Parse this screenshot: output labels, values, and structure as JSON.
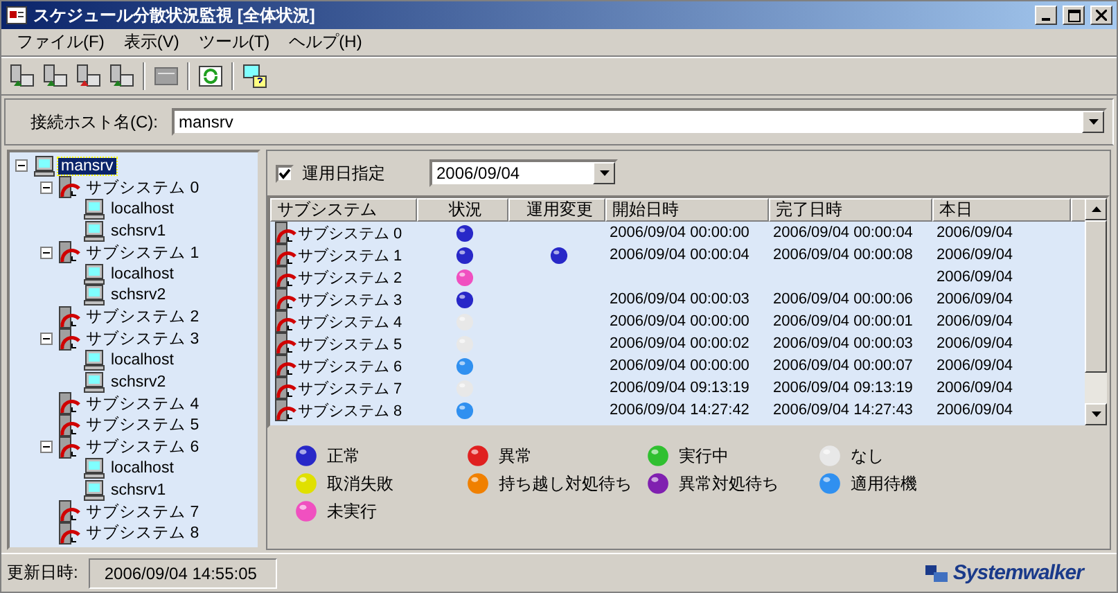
{
  "window": {
    "title": "スケジュール分散状況監視 [全体状況]"
  },
  "menu": [
    "ファイル(F)",
    "表示(V)",
    "ツール(T)",
    "ヘルプ(H)"
  ],
  "host": {
    "label": "接続ホスト名(C):",
    "value": "mansrv"
  },
  "tree": {
    "label": "mansrv",
    "selected": true,
    "expanded": true,
    "kind": "host",
    "children": [
      {
        "label": "サブシステム 0",
        "kind": "subsystem",
        "expanded": true,
        "children": [
          {
            "label": "localhost",
            "kind": "host"
          },
          {
            "label": "schsrv1",
            "kind": "host"
          }
        ]
      },
      {
        "label": "サブシステム 1",
        "kind": "subsystem",
        "expanded": true,
        "children": [
          {
            "label": "localhost",
            "kind": "host"
          },
          {
            "label": "schsrv2",
            "kind": "host"
          }
        ]
      },
      {
        "label": "サブシステム 2",
        "kind": "subsystem"
      },
      {
        "label": "サブシステム 3",
        "kind": "subsystem",
        "expanded": true,
        "children": [
          {
            "label": "localhost",
            "kind": "host"
          },
          {
            "label": "schsrv2",
            "kind": "host"
          }
        ]
      },
      {
        "label": "サブシステム 4",
        "kind": "subsystem"
      },
      {
        "label": "サブシステム 5",
        "kind": "subsystem"
      },
      {
        "label": "サブシステム 6",
        "kind": "subsystem",
        "expanded": true,
        "children": [
          {
            "label": "localhost",
            "kind": "host"
          },
          {
            "label": "schsrv1",
            "kind": "host"
          }
        ]
      },
      {
        "label": "サブシステム 7",
        "kind": "subsystem"
      },
      {
        "label": "サブシステム 8",
        "kind": "subsystem"
      }
    ]
  },
  "date_filter": {
    "label": "運用日指定",
    "checked": true,
    "value": "2006/09/04"
  },
  "table": {
    "columns": [
      "サブシステム",
      "状況",
      "運用変更",
      "開始日時",
      "完了日時",
      "本日"
    ],
    "rows": [
      {
        "subsystem": "サブシステム 0",
        "status": {
          "color": "#2828c8"
        },
        "start": "2006/09/04 00:00:00",
        "end": "2006/09/04 00:00:04",
        "today": "2006/09/04"
      },
      {
        "subsystem": "サブシステム 1",
        "status": {
          "color": "#2828c8"
        },
        "change": {
          "color": "#2828c8"
        },
        "start": "2006/09/04 00:00:04",
        "end": "2006/09/04 00:00:08",
        "today": "2006/09/04"
      },
      {
        "subsystem": "サブシステム 2",
        "status": {
          "color": "#f050c0"
        },
        "today": "2006/09/04"
      },
      {
        "subsystem": "サブシステム 3",
        "status": {
          "color": "#2828c8"
        },
        "start": "2006/09/04 00:00:03",
        "end": "2006/09/04 00:00:06",
        "today": "2006/09/04"
      },
      {
        "subsystem": "サブシステム 4",
        "status": {
          "color": "#e8e8e8"
        },
        "start": "2006/09/04 00:00:00",
        "end": "2006/09/04 00:00:01",
        "today": "2006/09/04"
      },
      {
        "subsystem": "サブシステム 5",
        "status": {
          "color": "#e8e8e8"
        },
        "start": "2006/09/04 00:00:02",
        "end": "2006/09/04 00:00:03",
        "today": "2006/09/04"
      },
      {
        "subsystem": "サブシステム 6",
        "status": {
          "color": "#3090f0"
        },
        "start": "2006/09/04 00:00:00",
        "end": "2006/09/04 00:00:07",
        "today": "2006/09/04"
      },
      {
        "subsystem": "サブシステム 7",
        "status": {
          "color": "#e8e8e8"
        },
        "start": "2006/09/04 09:13:19",
        "end": "2006/09/04 09:13:19",
        "today": "2006/09/04"
      },
      {
        "subsystem": "サブシステム 8",
        "status": {
          "color": "#3090f0"
        },
        "start": "2006/09/04 14:27:42",
        "end": "2006/09/04 14:27:43",
        "today": "2006/09/04"
      }
    ]
  },
  "legend": [
    {
      "label": "正常",
      "color": "#2828c8"
    },
    {
      "label": "異常",
      "color": "#e02020"
    },
    {
      "label": "実行中",
      "color": "#30c030"
    },
    {
      "label": "なし",
      "color": "#e8e8e8"
    },
    {
      "label": "取消失敗",
      "color": "#e0e000"
    },
    {
      "label": "持ち越し対処待ち",
      "color": "#f08000"
    },
    {
      "label": "異常対処待ち",
      "color": "#8020b0"
    },
    {
      "label": "適用待機",
      "color": "#3090f0"
    },
    {
      "label": "未実行",
      "color": "#f050c0"
    }
  ],
  "status_bar": {
    "label": "更新日時:",
    "value": "2006/09/04 14:55:05"
  },
  "logo": "Systemwalker"
}
